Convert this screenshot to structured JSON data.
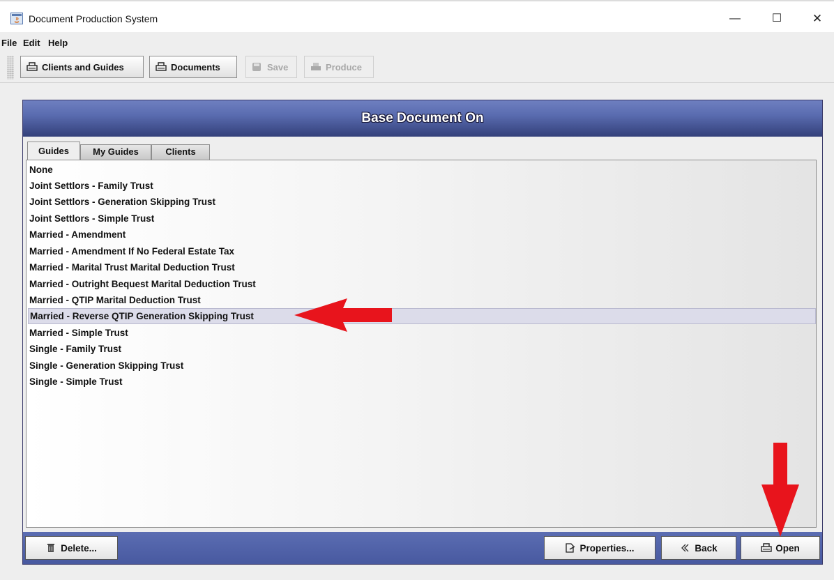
{
  "window": {
    "title": "Document Production System",
    "minimize_glyph": "—",
    "maximize_glyph": "☐",
    "close_glyph": "✕"
  },
  "menu": {
    "items": [
      "File",
      "Edit",
      "Help"
    ]
  },
  "toolbar": {
    "clients_and_guides_label": "Clients and Guides",
    "documents_label": "Documents",
    "save_label": "Save",
    "produce_label": "Produce"
  },
  "panel": {
    "title": "Base Document On",
    "tabs": [
      "Guides",
      "My Guides",
      "Clients"
    ],
    "active_tab": "Guides"
  },
  "guides": {
    "items": [
      "None",
      "Joint Settlors - Family Trust",
      "Joint Settlors - Generation Skipping Trust",
      "Joint Settlors - Simple Trust",
      "Married - Amendment",
      "Married - Amendment If No Federal Estate Tax",
      "Married - Marital Trust Marital Deduction Trust",
      "Married - Outright Bequest Marital Deduction Trust",
      "Married - QTIP Marital Deduction Trust",
      "Married - Reverse QTIP Generation Skipping Trust",
      "Married - Simple Trust",
      "Single - Family Trust",
      "Single - Generation Skipping Trust",
      "Single - Simple Trust"
    ],
    "selected": "Married - Reverse QTIP Generation Skipping Trust"
  },
  "footer": {
    "delete_label": "Delete...",
    "properties_label": "Properties...",
    "back_label": "Back",
    "open_label": "Open"
  },
  "colors": {
    "header_blue": "#5a6cb0",
    "footer_blue": "#4f60a6",
    "annotation_red": "#e8141c",
    "selection": "#dcdcea"
  },
  "icons": [
    "java-app-icon",
    "clients-icon",
    "documents-icon",
    "save-icon",
    "produce-icon",
    "trash-icon",
    "properties-icon",
    "back-chevron-icon",
    "open-icon"
  ]
}
